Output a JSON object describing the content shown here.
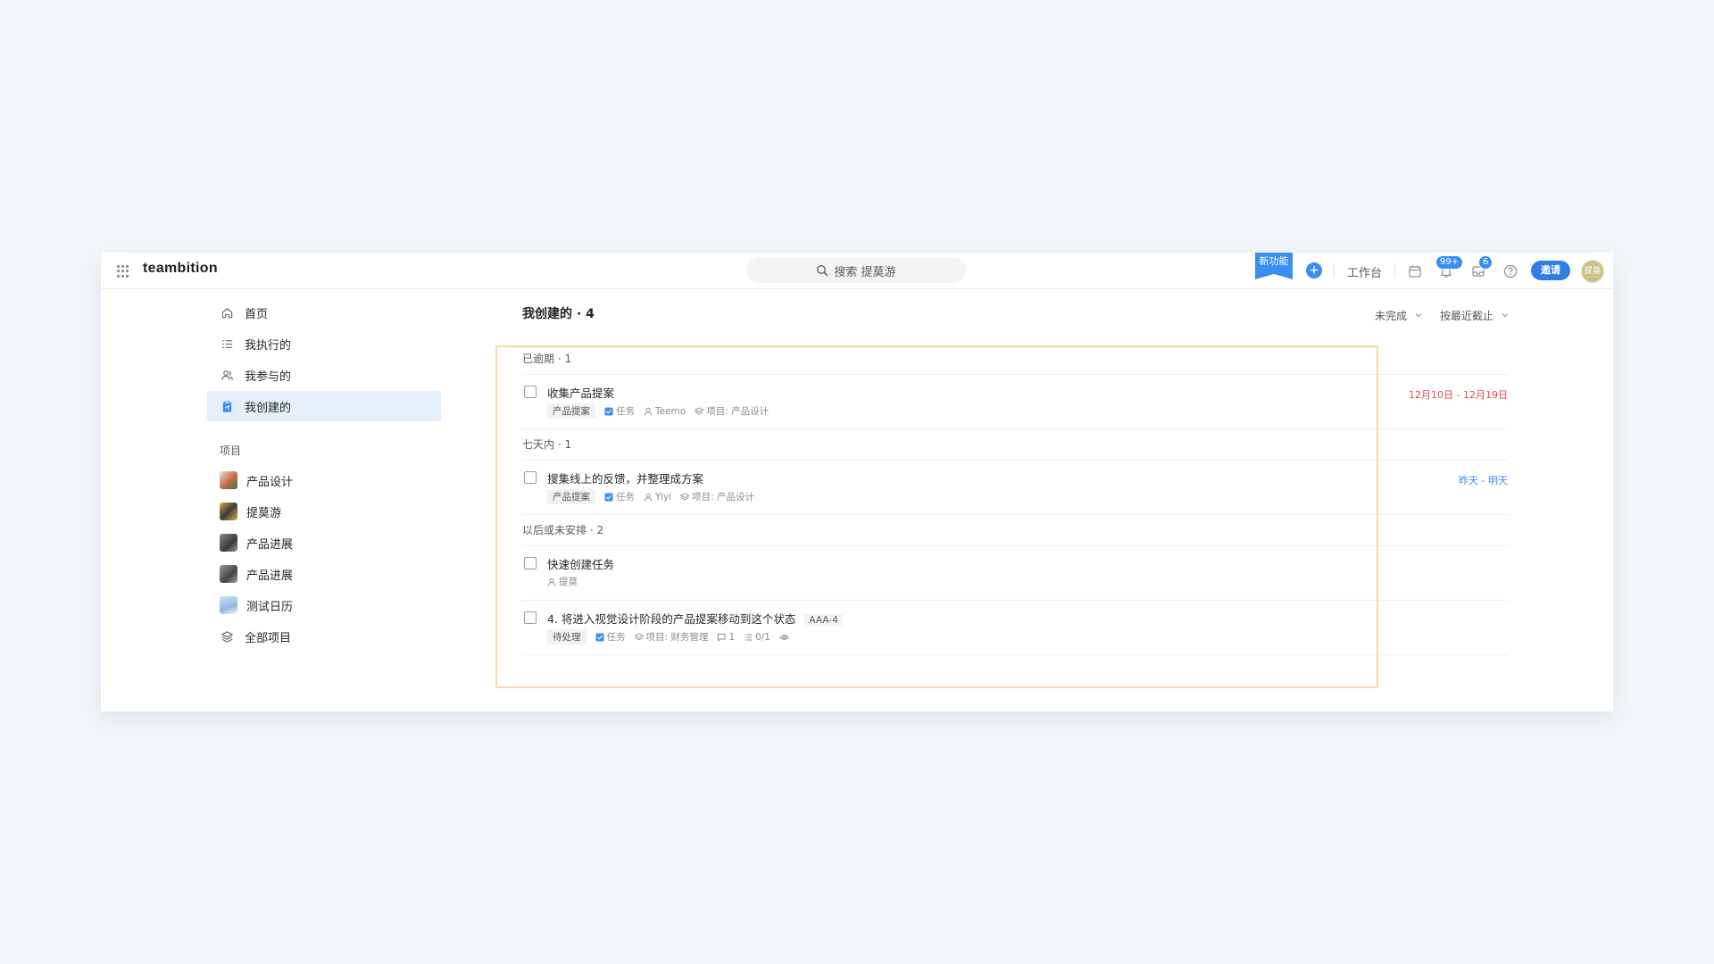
{
  "app": {
    "brand": "teambition",
    "search_placeholder": "搜索 提莫游",
    "new_feature_label": "新功能",
    "plus_label": "+",
    "workbench_label": "工作台",
    "notification_badge": "99+",
    "inbox_badge": "6",
    "invite_label": "邀请",
    "avatar_text": "提莫"
  },
  "sidebar": {
    "nav": [
      {
        "label": "首页",
        "icon": "home-icon"
      },
      {
        "label": "我执行的",
        "icon": "list-icon"
      },
      {
        "label": "我参与的",
        "icon": "users-icon"
      },
      {
        "label": "我创建的",
        "icon": "clipboard-icon",
        "active": true
      }
    ],
    "projects_title": "项目",
    "projects": [
      {
        "label": "产品设计",
        "thumb": "#c9684a"
      },
      {
        "label": "提莫游",
        "thumb": "#e0a93a"
      },
      {
        "label": "产品进展",
        "thumb": "#5a5a5a"
      },
      {
        "label": "产品进展",
        "thumb": "#6b6b6b"
      },
      {
        "label": "测试日历",
        "thumb": "#8fb8df"
      },
      {
        "label": "全部项目",
        "icon": "layers-icon"
      }
    ]
  },
  "main": {
    "title": "我创建的 · 4",
    "filter_status": "未完成",
    "filter_sort": "按最近截止",
    "sections": [
      {
        "title": "已逾期 · 1",
        "tasks": [
          {
            "title": "收集产品提案",
            "tag": "产品提案",
            "type": "任务",
            "assignee": "Teemo",
            "project": "项目: 产品设计",
            "due": "12月10日 - 12月19日",
            "due_color": "#e5484d"
          }
        ]
      },
      {
        "title": "七天内 · 1",
        "tasks": [
          {
            "title": "搜集线上的反馈，并整理成方案",
            "tag": "产品提案",
            "type": "任务",
            "assignee": "Yiyi",
            "project": "项目: 产品设计",
            "due": "昨天 - 明天",
            "due_color": "#3a8ef0"
          }
        ]
      },
      {
        "title": "以后或未安排 · 2",
        "tasks": [
          {
            "title": "快速创建任务",
            "assignee": "提莫"
          },
          {
            "title": "4. 将进入视觉设计阶段的产品提案移动到这个状态",
            "code": "AAA-4",
            "tag": "待处理",
            "type": "任务",
            "project": "项目: 财务管理",
            "comments": "1",
            "subtasks": "0/1"
          }
        ]
      }
    ]
  },
  "colors": {
    "accent": "#3a8ef0",
    "overdue": "#e5484d",
    "highlight": "#f4d9aa"
  }
}
